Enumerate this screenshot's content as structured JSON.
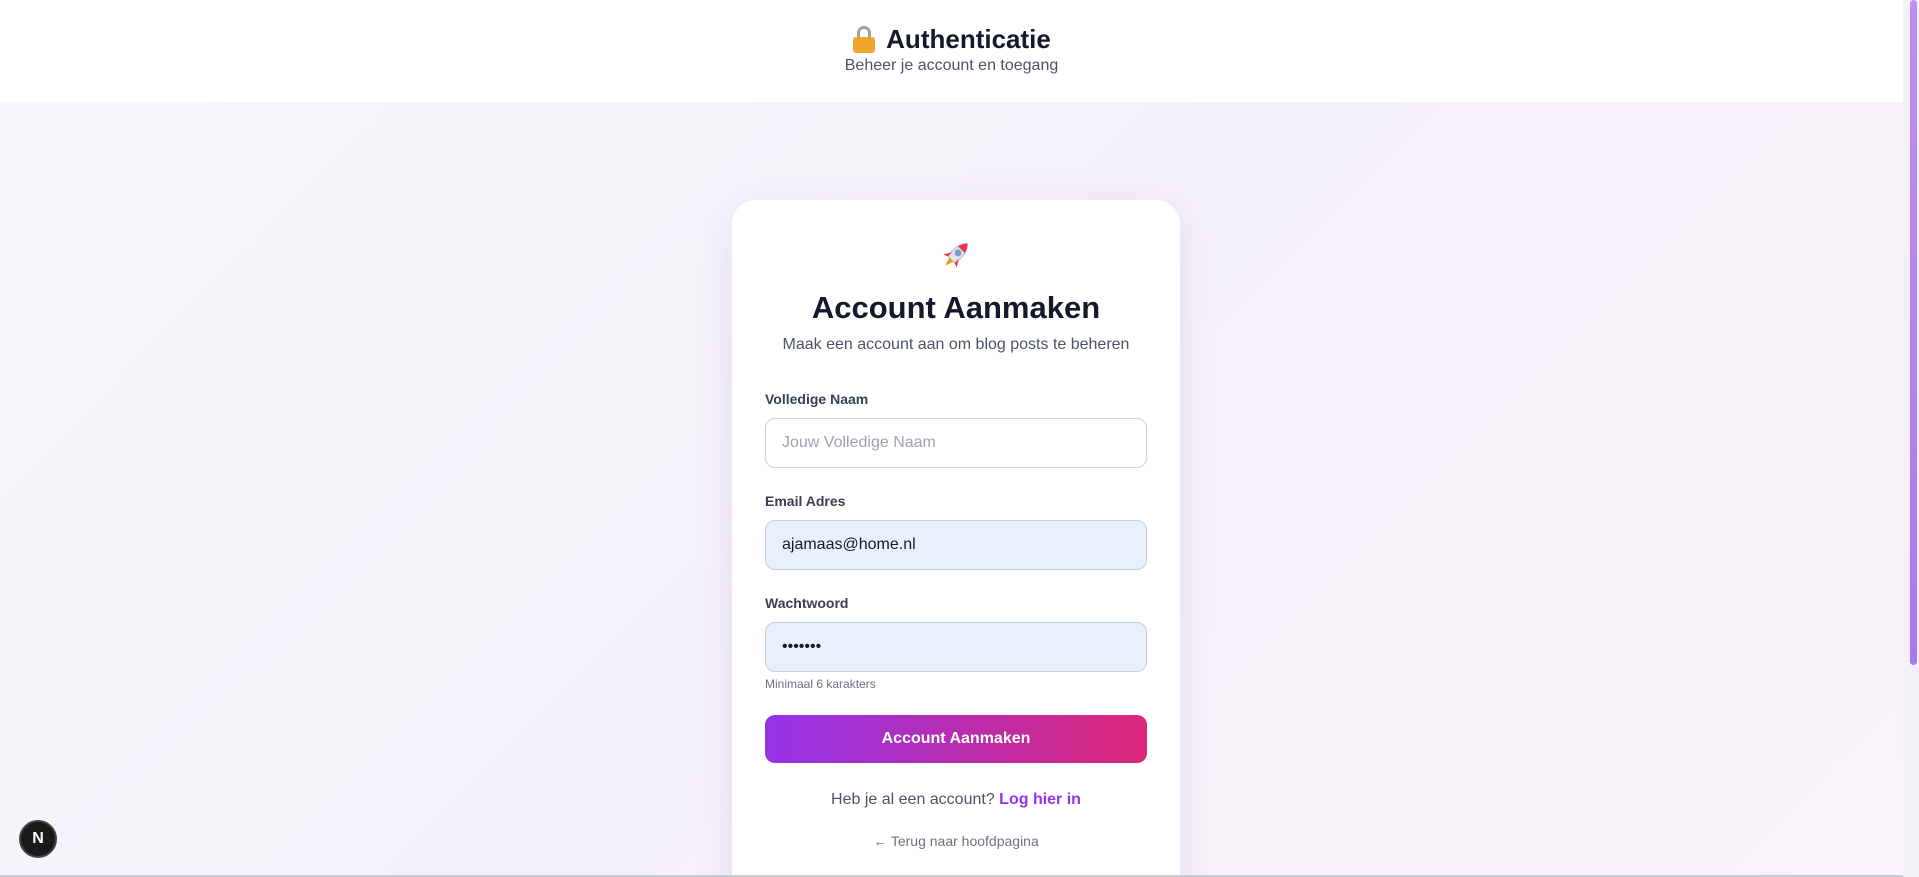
{
  "header": {
    "title": "Authenticatie",
    "title_icon": "lock-icon",
    "subtitle": "Beheer je account en toegang"
  },
  "card": {
    "icon": "rocket-icon",
    "title": "Account Aanmaken",
    "subtitle": "Maak een account aan om blog posts te beheren",
    "fields": [
      {
        "label": "Volledige Naam",
        "value": "",
        "placeholder": "Jouw Volledige Naam"
      },
      {
        "label": "Email Adres",
        "value": "ajamaas@home.nl",
        "placeholder": ""
      },
      {
        "label": "Wachtwoord",
        "value": "•••••••",
        "placeholder": ""
      }
    ],
    "password_hint": "Minimaal 6 karakters",
    "submit_label": "Account Aanmaken",
    "login_prompt": "Heb je al een account?",
    "login_link": "Log hier in",
    "back_link": "← Terug naar hoofdpagina"
  },
  "dev_badge": {
    "label": "N"
  },
  "colors": {
    "accent_start": "#9333ea",
    "accent_end": "#db2777",
    "input_filled_bg": "#e8f0fe"
  }
}
